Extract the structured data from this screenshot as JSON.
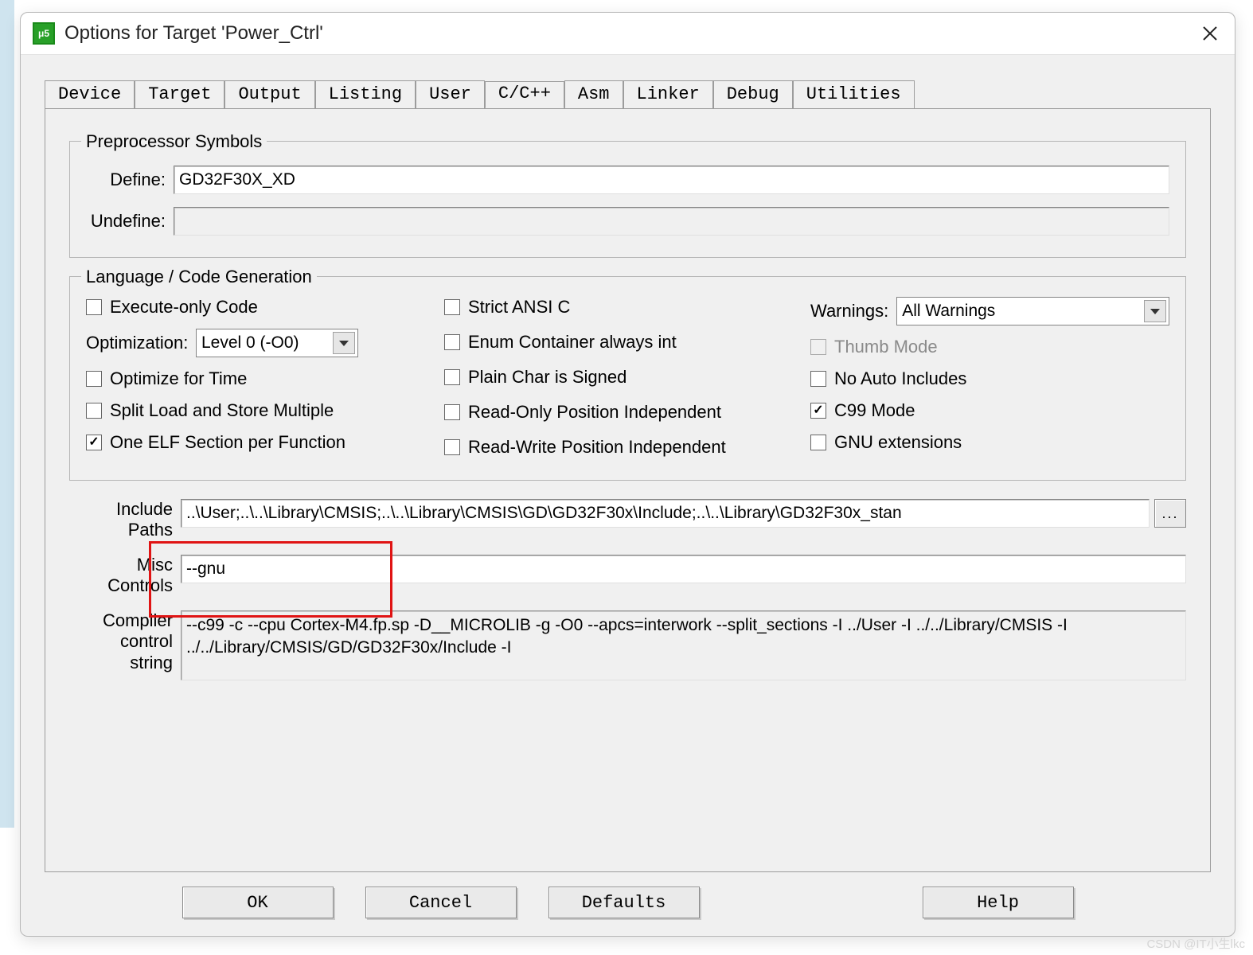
{
  "window": {
    "title": "Options for Target 'Power_Ctrl'",
    "icon_letter": "μ5"
  },
  "tabs": {
    "items": [
      "Device",
      "Target",
      "Output",
      "Listing",
      "User",
      "C/C++",
      "Asm",
      "Linker",
      "Debug",
      "Utilities"
    ],
    "active_index": 5
  },
  "preprocessor": {
    "legend": "Preprocessor Symbols",
    "define_label": "Define:",
    "define_value": "GD32F30X_XD",
    "undefine_label": "Undefine:",
    "undefine_value": ""
  },
  "lang": {
    "legend": "Language / Code Generation",
    "col1": {
      "execute_only": {
        "label": "Execute-only Code",
        "checked": false
      },
      "optimization_label": "Optimization:",
      "optimization_value": "Level 0 (-O0)",
      "optimize_time": {
        "label": "Optimize for Time",
        "checked": false
      },
      "split_load": {
        "label": "Split Load and Store Multiple",
        "checked": false
      },
      "one_elf": {
        "label": "One ELF Section per Function",
        "checked": true
      }
    },
    "col2": {
      "strict_ansi": {
        "label": "Strict ANSI C",
        "checked": false
      },
      "enum_container": {
        "label": "Enum Container always int",
        "checked": false
      },
      "plain_char": {
        "label": "Plain Char is Signed",
        "checked": false
      },
      "ro_pi": {
        "label": "Read-Only Position Independent",
        "checked": false
      },
      "rw_pi": {
        "label": "Read-Write Position Independent",
        "checked": false
      }
    },
    "col3": {
      "warnings_label": "Warnings:",
      "warnings_value": "All Warnings",
      "thumb": {
        "label": "Thumb Mode",
        "checked": false,
        "disabled": true
      },
      "no_auto": {
        "label": "No Auto Includes",
        "checked": false
      },
      "c99": {
        "label": "C99 Mode",
        "checked": true
      },
      "gnu": {
        "label": "GNU extensions",
        "checked": false
      }
    }
  },
  "paths": {
    "include_label": "Include\nPaths",
    "include_value": "..\\User;..\\..\\Library\\CMSIS;..\\..\\Library\\CMSIS\\GD\\GD32F30x\\Include;..\\..\\Library\\GD32F30x_stan",
    "misc_label": "Misc\nControls",
    "misc_value": "--gnu",
    "compiler_label": "Compiler\ncontrol\nstring",
    "compiler_value": "--c99 -c --cpu Cortex-M4.fp.sp -D__MICROLIB -g -O0 --apcs=interwork --split_sections -I ../User -I ../../Library/CMSIS -I ../../Library/CMSIS/GD/GD32F30x/Include -I",
    "browse_label": "..."
  },
  "buttons": {
    "ok": "OK",
    "cancel": "Cancel",
    "defaults": "Defaults",
    "help": "Help"
  },
  "watermark": "CSDN @IT小生lkc"
}
